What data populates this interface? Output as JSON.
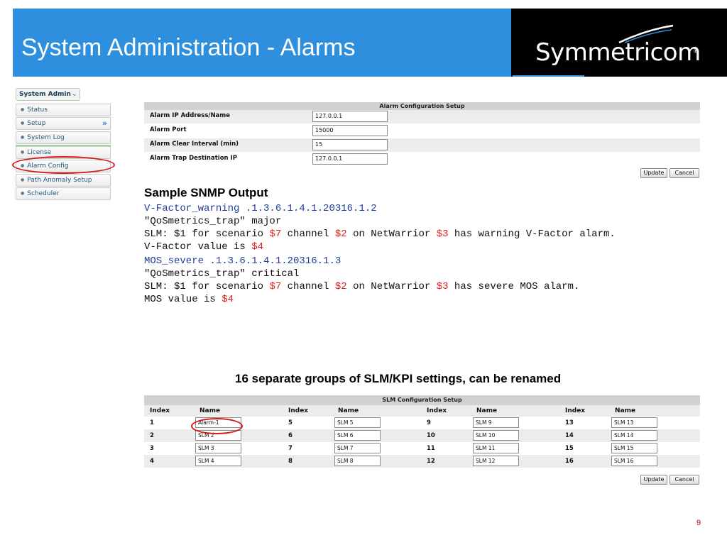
{
  "slide": {
    "title": "System Administration - Alarms",
    "page_number": "9"
  },
  "logo": {
    "text": "Symmetricom",
    "reg_mark": "®",
    "colors": {
      "background": "#000000",
      "text": "#ffffff"
    }
  },
  "colors": {
    "header_bg": "#2e8fde",
    "highlight_oval": "#d41818",
    "snmp_var": "#e02020",
    "snmp_trap": "#1f3d99"
  },
  "sidebar": {
    "header": "System Admin",
    "items": [
      {
        "label": "Status"
      },
      {
        "label": "Setup"
      },
      {
        "label": "System Log"
      },
      {
        "label": "License"
      },
      {
        "label": "Alarm Config"
      },
      {
        "label": "Path Anomaly Setup"
      },
      {
        "label": "Scheduler"
      }
    ]
  },
  "alarm_config": {
    "title": "Alarm Configuration Setup",
    "rows": [
      {
        "label": "Alarm IP Address/Name",
        "value": "127.0.0.1"
      },
      {
        "label": "Alarm Port",
        "value": "15000"
      },
      {
        "label": "Alarm Clear Interval (min)",
        "value": "15"
      },
      {
        "label": "Alarm Trap Destination IP",
        "value": "127.0.0.1"
      }
    ],
    "update_label": "Update",
    "cancel_label": "Cancel"
  },
  "snmp": {
    "heading": "Sample SNMP Output",
    "block1": {
      "trap_line": "V-Factor_warning .1.3.6.1.4.1.20316.1.2",
      "severity_line": "\"QoSmetrics_trap\" major",
      "msg_p1": "SLM: $1 for scenario ",
      "var_7": "$7",
      "msg_p2": " channel ",
      "var_2": "$2",
      "msg_p3": " on NetWarrior ",
      "var_3": "$3",
      "msg_p4": " has warning V-Factor alarm.",
      "value_prefix": "V-Factor value is ",
      "var_4": "$4"
    },
    "block2": {
      "trap_line": "MOS_severe .1.3.6.1.4.1.20316.1.3",
      "severity_line": "\"QoSmetrics_trap\" critical",
      "msg_p1": "SLM: $1 for scenario ",
      "var_7": "$7",
      "msg_p2": " channel ",
      "var_2": "$2",
      "msg_p3": " on NetWarrior ",
      "var_3": "$3",
      "msg_p4": " has severe MOS alarm.",
      "value_prefix": "MOS value is ",
      "var_4": "$4"
    }
  },
  "groups_caption": "16 separate groups of SLM/KPI settings, can be renamed",
  "slm_config": {
    "title": "SLM Configuration Setup",
    "index_header": "Index",
    "name_header": "Name",
    "columns": [
      [
        {
          "index": "1",
          "name": "Alarm-1"
        },
        {
          "index": "2",
          "name": "SLM 2"
        },
        {
          "index": "3",
          "name": "SLM 3"
        },
        {
          "index": "4",
          "name": "SLM 4"
        }
      ],
      [
        {
          "index": "5",
          "name": "SLM 5"
        },
        {
          "index": "6",
          "name": "SLM 6"
        },
        {
          "index": "7",
          "name": "SLM 7"
        },
        {
          "index": "8",
          "name": "SLM 8"
        }
      ],
      [
        {
          "index": "9",
          "name": "SLM 9"
        },
        {
          "index": "10",
          "name": "SLM 10"
        },
        {
          "index": "11",
          "name": "SLM 11"
        },
        {
          "index": "12",
          "name": "SLM 12"
        }
      ],
      [
        {
          "index": "13",
          "name": "SLM 13"
        },
        {
          "index": "14",
          "name": "SLM 14"
        },
        {
          "index": "15",
          "name": "SLM 15"
        },
        {
          "index": "16",
          "name": "SLM 16"
        }
      ]
    ],
    "update_label": "Update",
    "cancel_label": "Cancel"
  }
}
